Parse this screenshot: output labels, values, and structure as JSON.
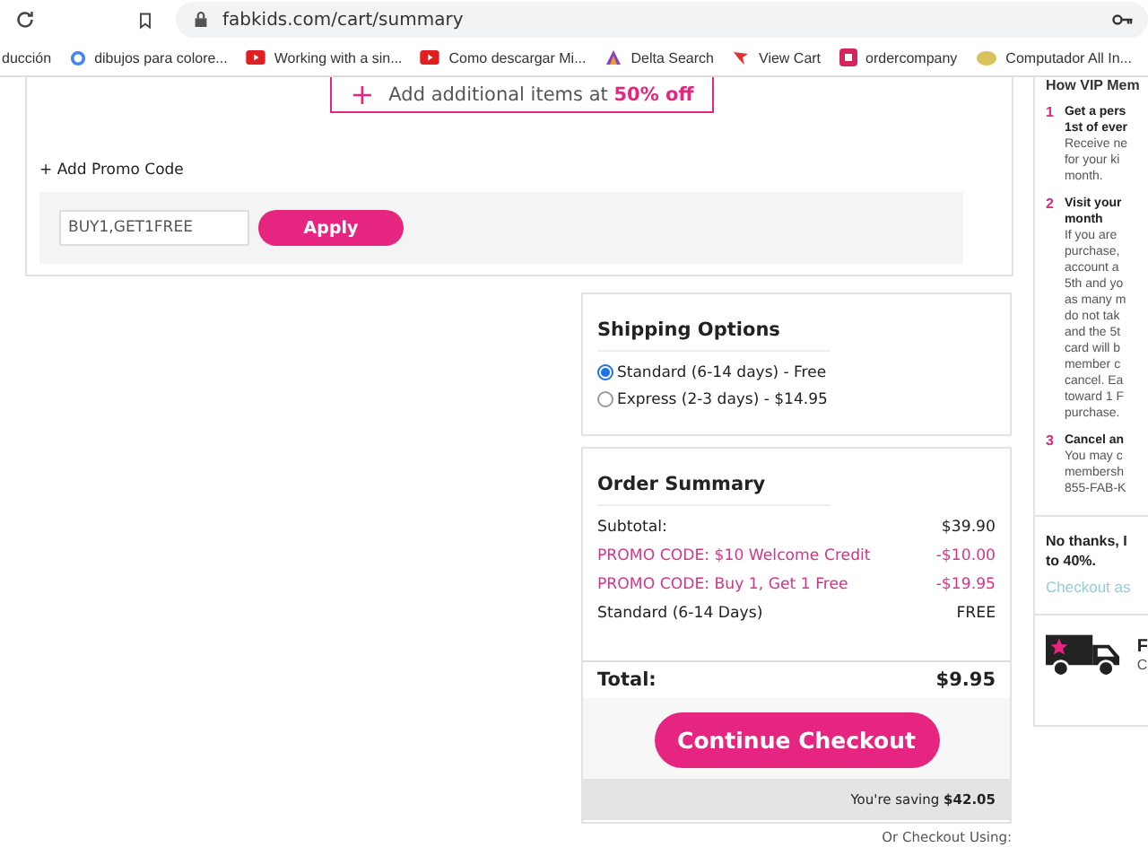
{
  "browser": {
    "url": "fabkids.com/cart/summary",
    "bookmarks": [
      {
        "label": "ducción",
        "kind": "none"
      },
      {
        "label": "dibujos para colore...",
        "kind": "google"
      },
      {
        "label": "Working with a sin...",
        "kind": "video"
      },
      {
        "label": "Como descargar Mi...",
        "kind": "video"
      },
      {
        "label": "Delta Search",
        "kind": "delta"
      },
      {
        "label": "View Cart",
        "kind": "bird"
      },
      {
        "label": "ordercompany",
        "kind": "square"
      },
      {
        "label": "Computador All In...",
        "kind": "disc"
      }
    ]
  },
  "cart": {
    "upsell": {
      "text": "Add additional items at **50% off**",
      "icon": "+"
    },
    "promo": {
      "link": "+ Add Promo Code",
      "value": "BUY1,GET1FREE",
      "button": "Apply"
    }
  },
  "shipping": {
    "title": "Shipping Options",
    "options": [
      {
        "label": "Standard (6-14 days) - Free",
        "selected": true
      },
      {
        "label": "Express (2-3 days) - $14.95",
        "selected": false
      }
    ]
  },
  "summary": {
    "title": "Order Summary",
    "lines": [
      {
        "label": "Subtotal:",
        "amount": "$39.90",
        "kind": "normal"
      },
      {
        "label": "PROMO CODE: $10 Welcome Credit",
        "amount": "-$10.00",
        "kind": "promo"
      },
      {
        "label": "PROMO CODE: Buy 1, Get 1 Free",
        "amount": "-$19.95",
        "kind": "promo"
      },
      {
        "label": "Standard (6-14 Days)",
        "amount": "FREE",
        "kind": "normal"
      }
    ],
    "total_label": "Total:",
    "total": "$9.95",
    "button": "Continue Checkout",
    "saving": "You're saving **$42.05**",
    "alt": "Or Checkout Using:"
  },
  "vip": {
    "heading": "How VIP Mem",
    "steps": [
      {
        "number": "1",
        "title": [
          "Get a pers",
          "1st of ever"
        ],
        "body": [
          "Receive ne",
          "for your ki",
          "month."
        ]
      },
      {
        "number": "2",
        "title": [
          "Visit your",
          "month"
        ],
        "body": [
          "If you are",
          "purchase,",
          "account a",
          "5th and yo",
          "as many m",
          "do not tak",
          "and the 5t",
          "card will b",
          "member c",
          "cancel. Ea",
          "toward 1 F",
          "purchase."
        ]
      },
      {
        "number": "3",
        "title": [
          "Cancel an"
        ],
        "body": [
          "You may c",
          "membersh",
          "855-FAB-K"
        ]
      }
    ],
    "decline": [
      "No thanks, I",
      "to 40%."
    ],
    "guest": "Checkout as",
    "shipping_title": "F",
    "shipping_text": "C"
  }
}
